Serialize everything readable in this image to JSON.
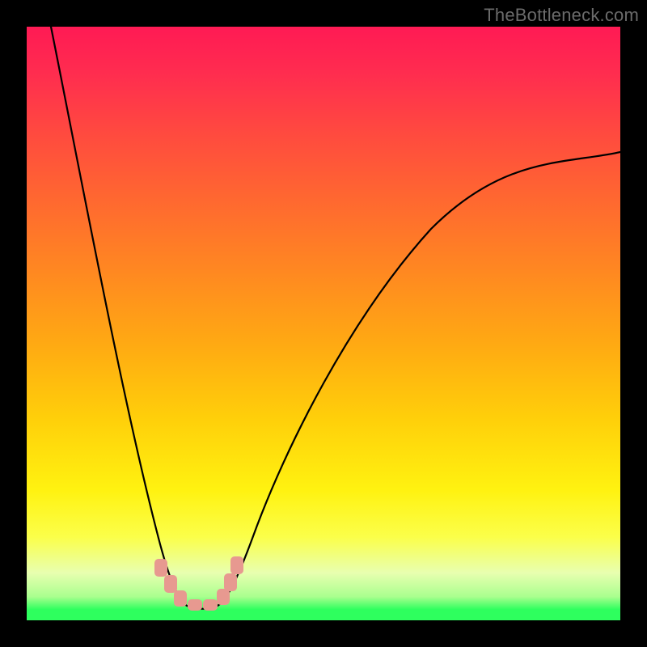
{
  "watermark": "TheBottleneck.com",
  "colors": {
    "frame": "#000000",
    "gradient_top": "#ff1a54",
    "gradient_bottom": "#2eff5e",
    "curve": "#000000",
    "beads": "#e79990"
  },
  "chart_data": {
    "type": "line",
    "title": "",
    "xlabel": "",
    "ylabel": "",
    "xlim": [
      0,
      100
    ],
    "ylim": [
      0,
      100
    ],
    "notes": "Bottleneck-style V curve. No axis tick labels are visible; values are estimated positions on a 0–100 normalized plot area.",
    "series": [
      {
        "name": "left-branch",
        "x": [
          4,
          8,
          12,
          16,
          19,
          22,
          24,
          26
        ],
        "y": [
          100,
          75,
          50,
          28,
          14,
          7,
          4,
          2.5
        ]
      },
      {
        "name": "valley",
        "x": [
          26,
          28,
          30,
          32
        ],
        "y": [
          2.5,
          2,
          2,
          2.5
        ]
      },
      {
        "name": "right-branch",
        "x": [
          32,
          36,
          42,
          50,
          60,
          72,
          86,
          100
        ],
        "y": [
          2.5,
          8,
          22,
          40,
          55,
          66,
          74,
          79
        ]
      }
    ],
    "annotations": {
      "beads": [
        {
          "x": 22.5,
          "y": 8
        },
        {
          "x": 24.0,
          "y": 5
        },
        {
          "x": 25.5,
          "y": 3
        },
        {
          "x": 27.5,
          "y": 2.2
        },
        {
          "x": 30.0,
          "y": 2.2
        },
        {
          "x": 32.0,
          "y": 3.5
        },
        {
          "x": 33.2,
          "y": 6
        },
        {
          "x": 34.2,
          "y": 8.5
        }
      ]
    }
  }
}
